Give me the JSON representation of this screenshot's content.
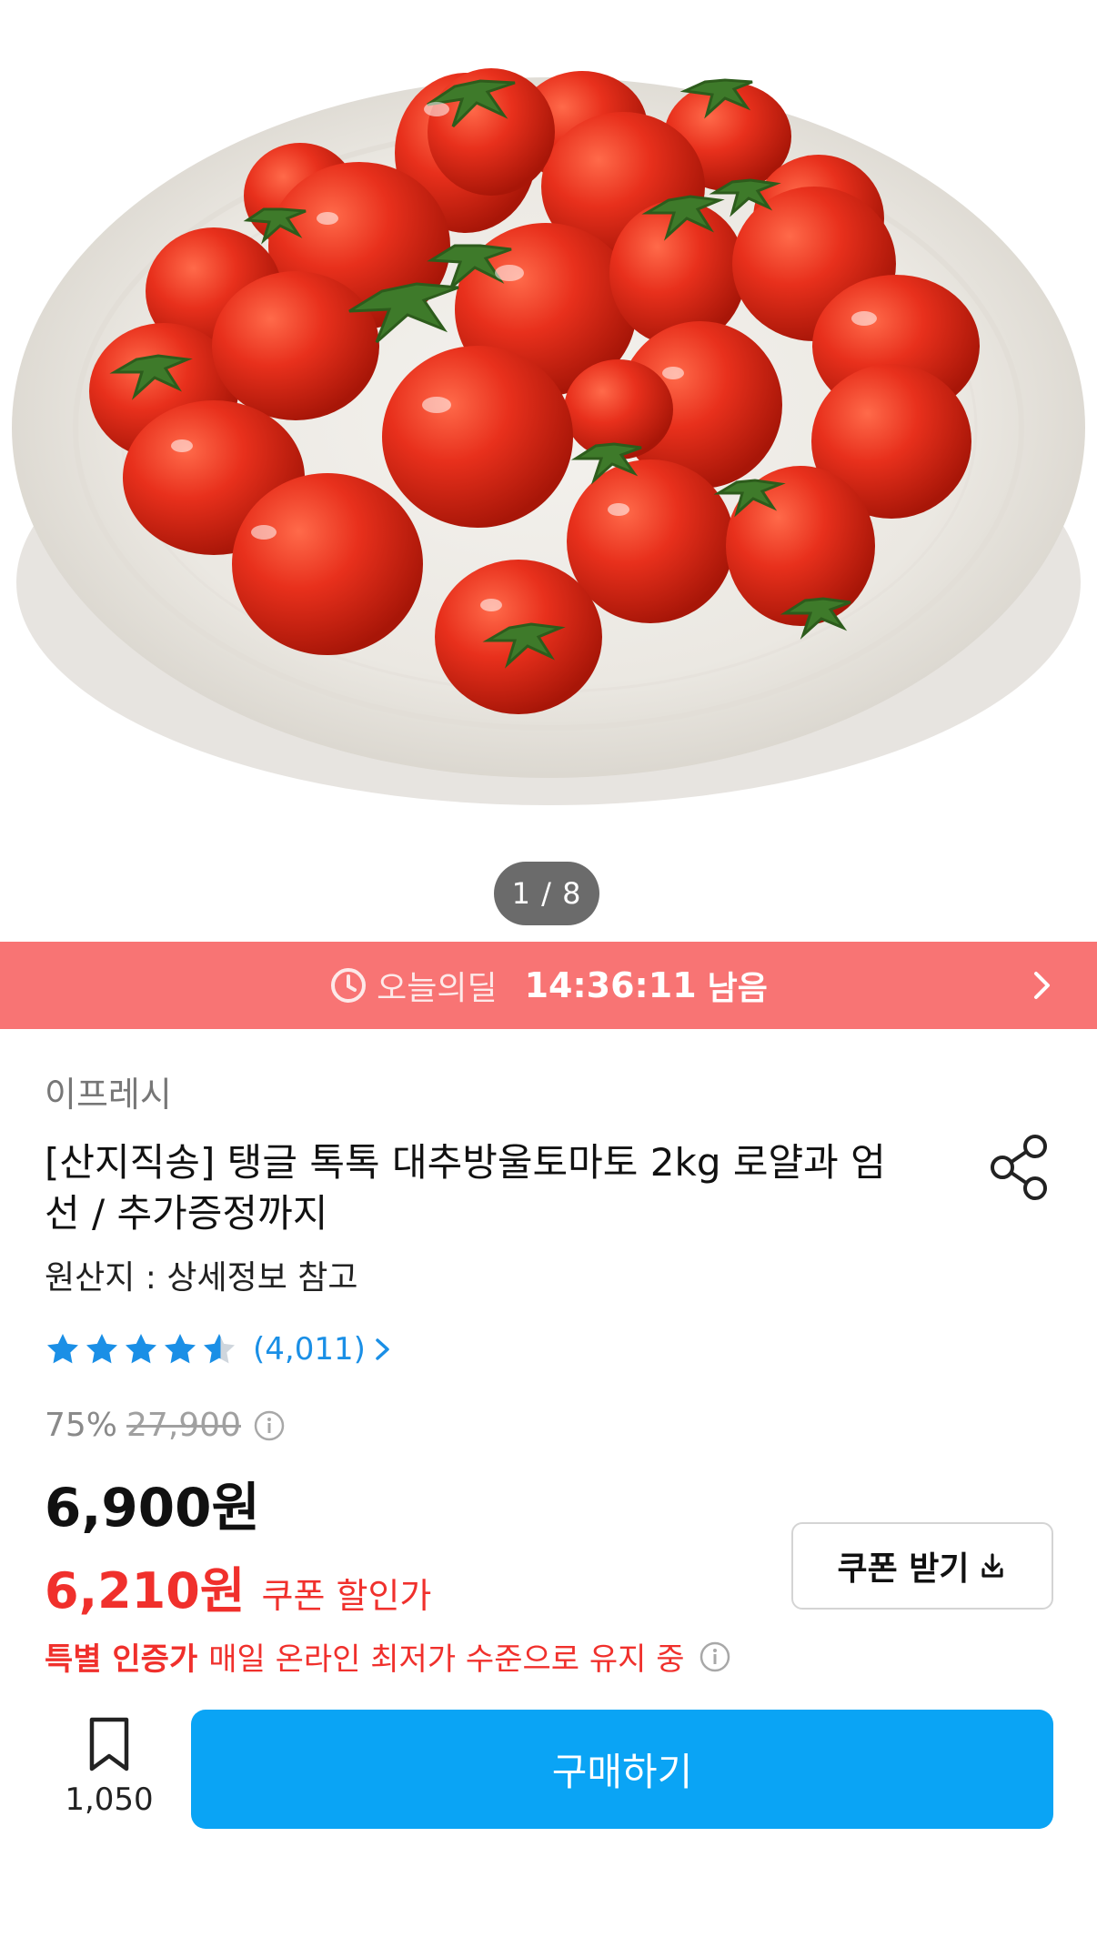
{
  "gallery": {
    "pager": "1 / 8",
    "image_subject": "cherry-tomatoes-on-plate"
  },
  "deal": {
    "label": "오늘의딜",
    "time": "14:36:11",
    "suffix": "남음",
    "icon": "clock-icon",
    "color": "#f87474"
  },
  "product": {
    "seller": "이프레시",
    "title": "[산지직송] 탱글 톡톡 대추방울토마토 2kg 로얄과 엄선 / 추가증정까지",
    "origin": "원산지 : 상세정보 참고",
    "rating": {
      "stars": 4.5,
      "count": "(4,011)"
    },
    "discount_percent": "75%",
    "original_price": "27,900",
    "price": "6,900원",
    "coupon_price": "6,210원",
    "coupon_price_label": "쿠폰 할인가",
    "coupon_button": "쿠폰 받기",
    "special_label": "특별 인증가",
    "special_text": "매일 온라인 최저가 수준으로 유지 중"
  },
  "footer": {
    "bookmark_count": "1,050",
    "buy_label": "구매하기"
  },
  "colors": {
    "accent_blue": "#0aa4f5",
    "sale_red": "#f0302c",
    "star_blue": "#1a8fe6"
  }
}
